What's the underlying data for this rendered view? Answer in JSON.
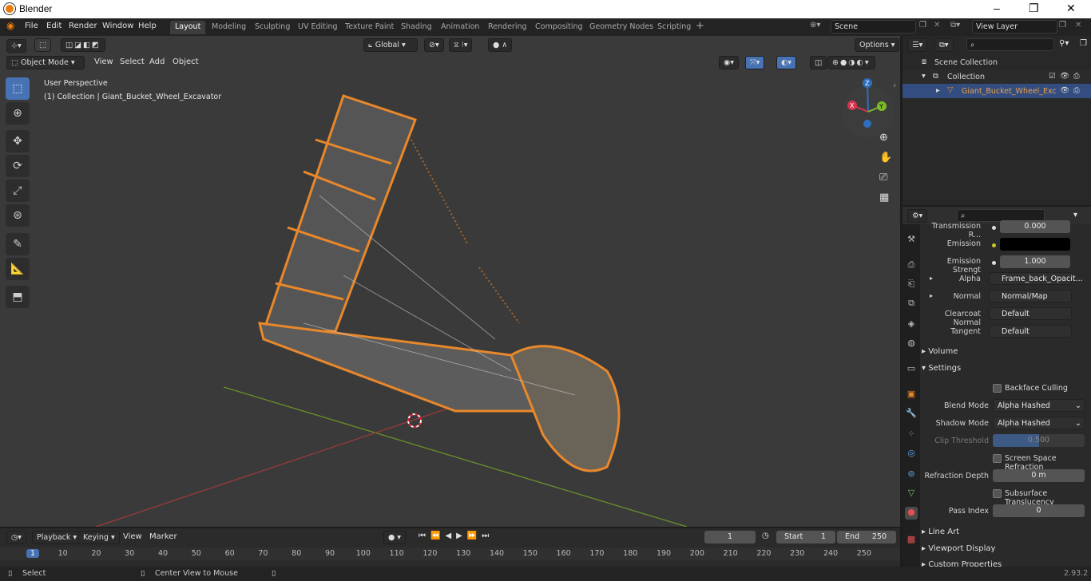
{
  "window": {
    "title": "Blender",
    "controls": [
      "–",
      "❐",
      "✕"
    ]
  },
  "menu": [
    "File",
    "Edit",
    "Render",
    "Window",
    "Help"
  ],
  "workspaces": [
    {
      "label": "Layout",
      "active": true
    },
    {
      "label": "Modeling"
    },
    {
      "label": "Sculpting"
    },
    {
      "label": "UV Editing"
    },
    {
      "label": "Texture Paint"
    },
    {
      "label": "Shading"
    },
    {
      "label": "Animation"
    },
    {
      "label": "Rendering"
    },
    {
      "label": "Compositing"
    },
    {
      "label": "Geometry Nodes"
    },
    {
      "label": "Scripting"
    }
  ],
  "scene": {
    "name": "Scene",
    "view_layer": "View Layer"
  },
  "viewport_header": {
    "transform_orientation": "Global",
    "options": "Options",
    "mode": "Object Mode",
    "menus": [
      "View",
      "Select",
      "Add",
      "Object"
    ]
  },
  "viewport_overlay": {
    "perspective": "User Perspective",
    "collection": "(1) Collection | Giant_Bucket_Wheel_Excavator"
  },
  "gizmo": {
    "z": "Z",
    "x": "X",
    "y": "Y"
  },
  "outliner": {
    "scene_collection": "Scene Collection",
    "collection": "Collection",
    "object": "Giant_Bucket_Wheel_Exc"
  },
  "properties": {
    "rows": [
      {
        "label": "Transmission R...",
        "value": "0.000"
      },
      {
        "label": "Emission",
        "value": ""
      },
      {
        "label": "Emission Strengt",
        "value": "1.000"
      },
      {
        "label": "Alpha",
        "value": "Frame_back_Opacit..."
      },
      {
        "label": "Normal",
        "value": "Normal/Map"
      },
      {
        "label": "Clearcoat Normal",
        "value": "Default"
      },
      {
        "label": "Tangent",
        "value": "Default"
      }
    ],
    "volume": "Volume",
    "settings": "Settings",
    "backface_culling": "Backface Culling",
    "blend_mode_label": "Blend Mode",
    "blend_mode": "Alpha Hashed",
    "shadow_mode_label": "Shadow Mode",
    "shadow_mode": "Alpha Hashed",
    "clip_threshold_label": "Clip Threshold",
    "clip_threshold": "0.500",
    "clip_threshold_fraction": 0.5,
    "ssr": "Screen Space Refraction",
    "refraction_depth_label": "Refraction Depth",
    "refraction_depth": "0 m",
    "subsurface": "Subsurface Translucency",
    "pass_index_label": "Pass Index",
    "pass_index": "0",
    "line_art": "Line Art",
    "viewport_display": "Viewport Display",
    "custom_properties": "Custom Properties"
  },
  "timeline": {
    "menus": [
      "Playback",
      "Keying",
      "View",
      "Marker"
    ],
    "current_frame": "1",
    "start_label": "Start",
    "start": "1",
    "end_label": "End",
    "end": "250",
    "ticks": [
      "1",
      "10",
      "20",
      "30",
      "40",
      "50",
      "60",
      "70",
      "80",
      "90",
      "100",
      "110",
      "120",
      "130",
      "140",
      "150",
      "160",
      "170",
      "180",
      "190",
      "200",
      "210",
      "220",
      "230",
      "240",
      "250"
    ]
  },
  "status": {
    "left": "Select",
    "mid": "Center View to Mouse",
    "version": "2.93.2"
  },
  "colors": {
    "accent": "#4772b3",
    "selection": "#e8882a",
    "bg": "#3a3a3a"
  }
}
